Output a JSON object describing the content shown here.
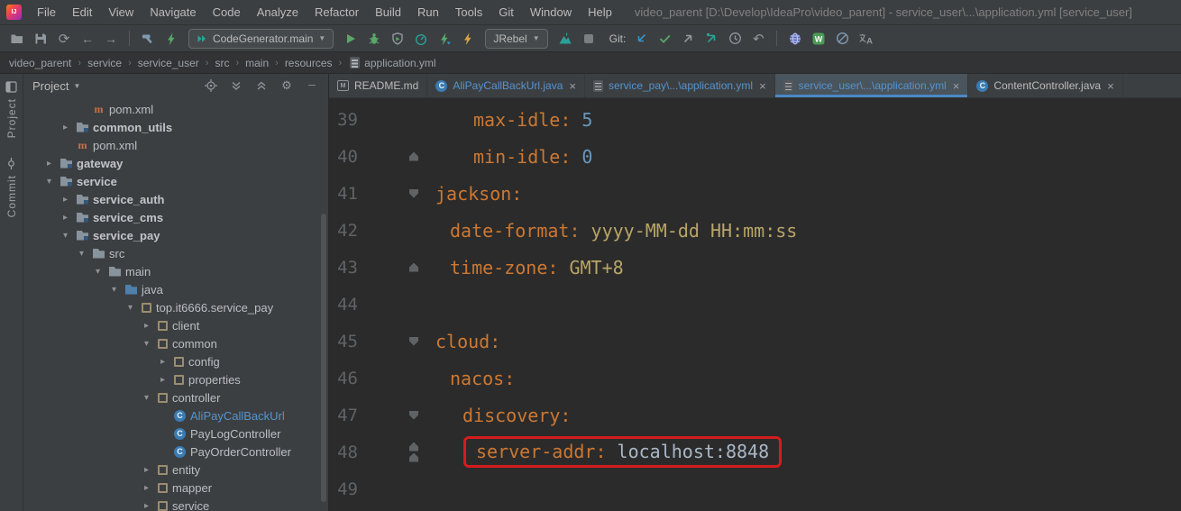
{
  "window_title": "video_parent [D:\\Develop\\IdeaPro\\video_parent] - service_user\\...\\application.yml [service_user]",
  "menus": [
    "File",
    "Edit",
    "View",
    "Navigate",
    "Code",
    "Analyze",
    "Refactor",
    "Build",
    "Run",
    "Tools",
    "Git",
    "Window",
    "Help"
  ],
  "toolbar": {
    "run_config": "CodeGenerator.main",
    "jrebel_label": "JRebel",
    "git_label": "Git:",
    "icons": [
      "open-folder",
      "save-all",
      "synchronize",
      "back",
      "forward",
      "build-hammer",
      "bolt",
      "run-config",
      "run",
      "debug",
      "run-with-coverage",
      "profiler",
      "jrebel-run",
      "jrebel-debug",
      "mountain",
      "stop",
      "git-update",
      "git-commit",
      "git-push",
      "git-push-tags",
      "history",
      "rollback",
      "globe",
      "w-plugin",
      "do-not-disturb",
      "translate"
    ]
  },
  "breadcrumbs": [
    "video_parent",
    "service",
    "service_user",
    "src",
    "main",
    "resources",
    "application.yml"
  ],
  "stripe": {
    "project_label": "Project",
    "commit_label": "Commit"
  },
  "project_panel": {
    "header": "Project",
    "tree": [
      {
        "label": "pom.xml",
        "icon": "maven",
        "level": 2,
        "chevron": "none",
        "bold": false,
        "highlight": false
      },
      {
        "label": "common_utils",
        "icon": "module",
        "level": 1,
        "chevron": "collapsed",
        "bold": true,
        "highlight": false
      },
      {
        "label": "pom.xml",
        "icon": "maven",
        "level": 1,
        "chevron": "none",
        "bold": false,
        "highlight": false
      },
      {
        "label": "gateway",
        "icon": "module",
        "level": 0,
        "chevron": "collapsed",
        "bold": true,
        "highlight": false
      },
      {
        "label": "service",
        "icon": "module",
        "level": 0,
        "chevron": "expanded",
        "bold": true,
        "highlight": false
      },
      {
        "label": "service_auth",
        "icon": "module",
        "level": 1,
        "chevron": "collapsed",
        "bold": true,
        "highlight": false
      },
      {
        "label": "service_cms",
        "icon": "module",
        "level": 1,
        "chevron": "collapsed",
        "bold": true,
        "highlight": false
      },
      {
        "label": "service_pay",
        "icon": "module",
        "level": 1,
        "chevron": "expanded",
        "bold": true,
        "highlight": false
      },
      {
        "label": "src",
        "icon": "folder",
        "level": 2,
        "chevron": "expanded",
        "bold": false,
        "highlight": false
      },
      {
        "label": "main",
        "icon": "folder",
        "level": 3,
        "chevron": "expanded",
        "bold": false,
        "highlight": false
      },
      {
        "label": "java",
        "icon": "source",
        "level": 4,
        "chevron": "expanded",
        "bold": false,
        "highlight": false
      },
      {
        "label": "top.it6666.service_pay",
        "icon": "package",
        "level": 5,
        "chevron": "expanded",
        "bold": false,
        "highlight": false
      },
      {
        "label": "client",
        "icon": "package",
        "level": 6,
        "chevron": "collapsed",
        "bold": false,
        "highlight": false
      },
      {
        "label": "common",
        "icon": "package",
        "level": 6,
        "chevron": "expanded",
        "bold": false,
        "highlight": false
      },
      {
        "label": "config",
        "icon": "package",
        "level": 7,
        "chevron": "collapsed",
        "bold": false,
        "highlight": false
      },
      {
        "label": "properties",
        "icon": "package",
        "level": 7,
        "chevron": "collapsed",
        "bold": false,
        "highlight": false
      },
      {
        "label": "controller",
        "icon": "package",
        "level": 6,
        "chevron": "expanded",
        "bold": false,
        "highlight": false
      },
      {
        "label": "AliPayCallBackUrl",
        "icon": "class",
        "level": 7,
        "chevron": "none",
        "bold": false,
        "highlight": true
      },
      {
        "label": "PayLogController",
        "icon": "class",
        "level": 7,
        "chevron": "none",
        "bold": false,
        "highlight": false
      },
      {
        "label": "PayOrderController",
        "icon": "class",
        "level": 7,
        "chevron": "none",
        "bold": false,
        "highlight": false
      },
      {
        "label": "entity",
        "icon": "package",
        "level": 6,
        "chevron": "collapsed",
        "bold": false,
        "highlight": false
      },
      {
        "label": "mapper",
        "icon": "package",
        "level": 6,
        "chevron": "collapsed",
        "bold": false,
        "highlight": false
      },
      {
        "label": "service",
        "icon": "package",
        "level": 6,
        "chevron": "collapsed",
        "bold": false,
        "highlight": false
      }
    ]
  },
  "editor_tabs": [
    {
      "label": "README.md",
      "icon": "markdown",
      "blue": false,
      "close": false,
      "selected": false
    },
    {
      "label": "AliPayCallBackUrl.java",
      "icon": "class",
      "blue": true,
      "close": true,
      "selected": false
    },
    {
      "label": "service_pay\\...\\application.yml",
      "icon": "yaml",
      "blue": true,
      "close": true,
      "selected": false
    },
    {
      "label": "service_user\\...\\application.yml",
      "icon": "yaml",
      "blue": true,
      "close": true,
      "selected": true
    },
    {
      "label": "ContentController.java",
      "icon": "class",
      "blue": false,
      "close": true,
      "selected": false
    }
  ],
  "editor": {
    "lines": [
      {
        "num": 39,
        "indent": 42,
        "fold": "",
        "highlight": false,
        "tokens": [
          {
            "t": "max-idle: ",
            "c": "key"
          },
          {
            "t": "5",
            "c": "num"
          }
        ]
      },
      {
        "num": 40,
        "indent": 42,
        "fold": "end",
        "highlight": false,
        "tokens": [
          {
            "t": "min-idle: ",
            "c": "key"
          },
          {
            "t": "0",
            "c": "num"
          }
        ]
      },
      {
        "num": 41,
        "indent": 0,
        "fold": "start",
        "highlight": false,
        "tokens": [
          {
            "t": "jackson:",
            "c": "key"
          }
        ]
      },
      {
        "num": 42,
        "indent": 16,
        "fold": "",
        "highlight": false,
        "tokens": [
          {
            "t": "date-format: ",
            "c": "key"
          },
          {
            "t": "yyyy-MM-dd HH:mm:ss",
            "c": "str"
          }
        ]
      },
      {
        "num": 43,
        "indent": 16,
        "fold": "end",
        "highlight": false,
        "tokens": [
          {
            "t": "time-zone: ",
            "c": "key"
          },
          {
            "t": "GMT+8",
            "c": "str"
          }
        ]
      },
      {
        "num": 44,
        "indent": 0,
        "fold": "",
        "highlight": false,
        "tokens": []
      },
      {
        "num": 45,
        "indent": 0,
        "fold": "start",
        "highlight": false,
        "tokens": [
          {
            "t": "cloud:",
            "c": "key"
          }
        ]
      },
      {
        "num": 46,
        "indent": 16,
        "fold": "",
        "highlight": false,
        "tokens": [
          {
            "t": "nacos:",
            "c": "key"
          }
        ]
      },
      {
        "num": 47,
        "indent": 30,
        "fold": "start",
        "highlight": false,
        "tokens": [
          {
            "t": "discovery:",
            "c": "key"
          }
        ]
      },
      {
        "num": 48,
        "indent": 42,
        "fold": "end2",
        "highlight": true,
        "tokens": [
          {
            "t": "server-addr: ",
            "c": "key"
          },
          {
            "t": "localhost:8848",
            "c": "text"
          }
        ]
      },
      {
        "num": 49,
        "indent": 0,
        "fold": "",
        "highlight": false,
        "tokens": []
      }
    ]
  },
  "colors": {
    "yaml_key": "#cc7832",
    "yaml_number": "#6897bb",
    "yaml_string": "#b8a566",
    "yaml_text": "#a9b7c6",
    "highlight_border": "#d41c1c",
    "tab_underline": "#4a88c7",
    "open_file_blue": "#5693cf"
  }
}
